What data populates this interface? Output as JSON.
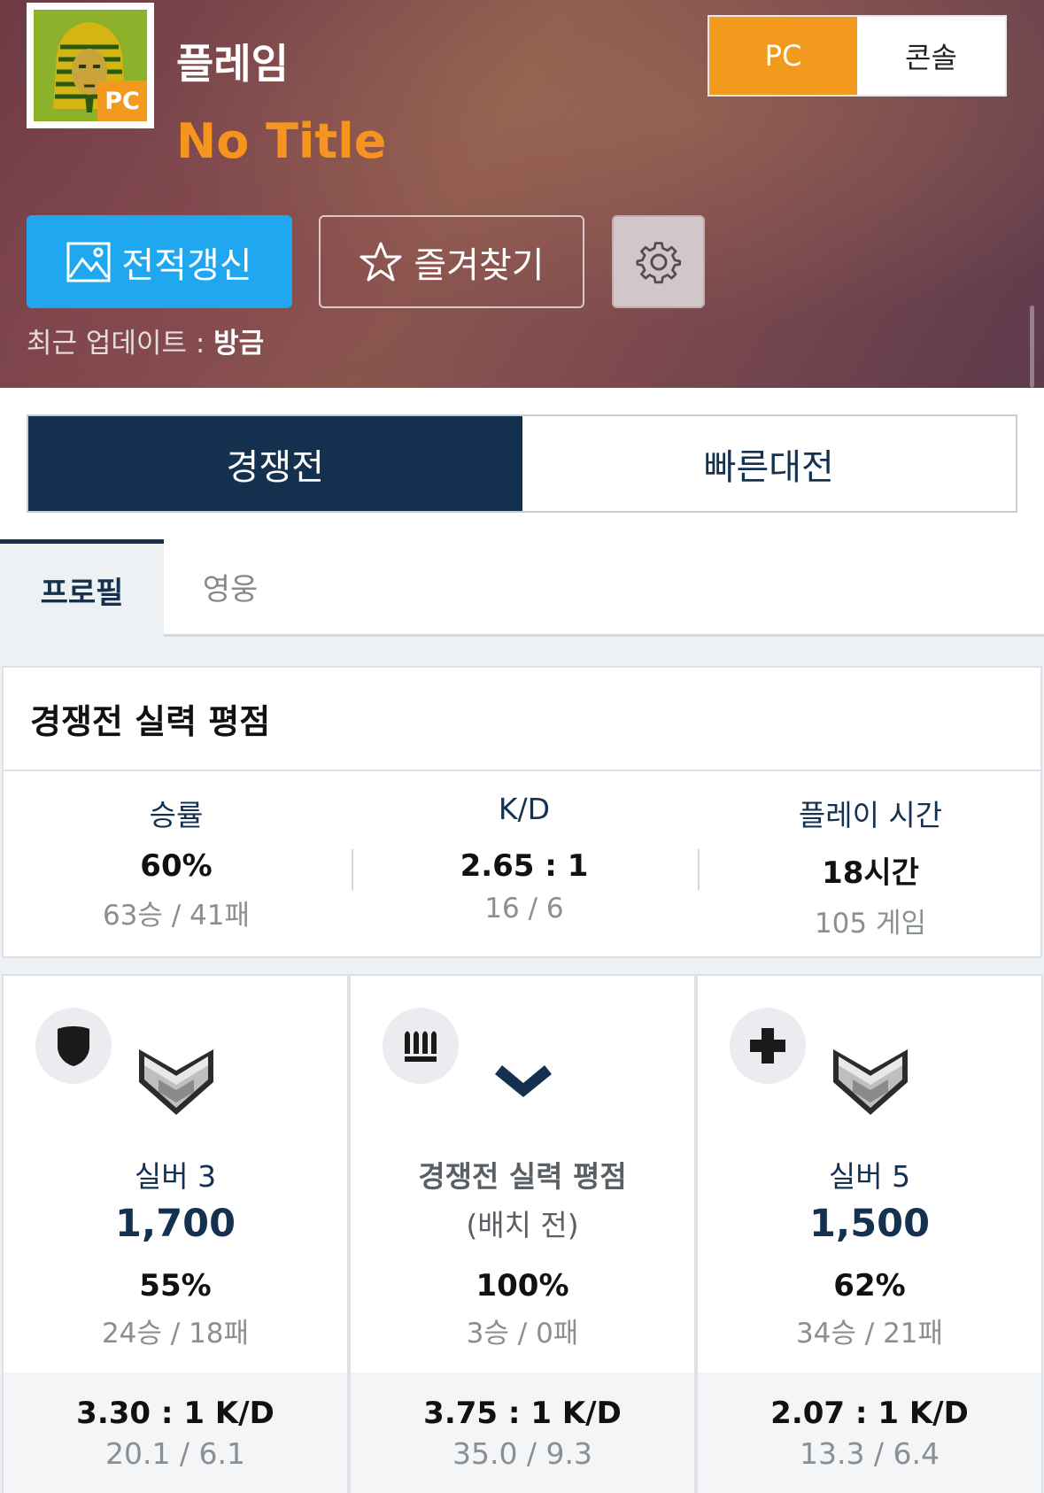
{
  "header": {
    "player_name": "플레임",
    "player_title": "No Title",
    "avatar_badge": "PC",
    "platform_tabs": [
      "PC",
      "콘솔"
    ],
    "refresh_label": "전적갱신",
    "favorite_label": "즐겨찾기",
    "last_update_label": "최근 업데이트 : ",
    "last_update_value": "방금"
  },
  "mode_tabs": [
    "경쟁전",
    "빠른대전"
  ],
  "sub_tabs": [
    "프로필",
    "영웅"
  ],
  "summary": {
    "title": "경쟁전 실력 평점",
    "stats": [
      {
        "label": "승률",
        "value": "60%",
        "sub": "63승 / 41패"
      },
      {
        "label": "K/D",
        "value": "2.65 : 1",
        "sub": "16 / 6"
      },
      {
        "label": "플레이 시간",
        "value": "18시간",
        "sub": "105 게임"
      }
    ]
  },
  "roles": [
    {
      "role_icon": "shield-icon",
      "rank_name": "실버 3",
      "sr": "1,700",
      "winrate": "55%",
      "record": "24승 / 18패",
      "kd": "3.30 : 1 K/D",
      "kd_detail": "20.1 / 6.1"
    },
    {
      "role_icon": "ammo-icon",
      "placement_title": "경쟁전 실력 평점",
      "placement_sub": "(배치 전)",
      "winrate": "100%",
      "record": "3승 / 0패",
      "kd": "3.75 : 1 K/D",
      "kd_detail": "35.0 / 9.3"
    },
    {
      "role_icon": "plus-icon",
      "rank_name": "실버 5",
      "sr": "1,500",
      "winrate": "62%",
      "record": "34승 / 21패",
      "kd": "2.07 : 1 K/D",
      "kd_detail": "13.3 / 6.4"
    }
  ],
  "colors": {
    "accent_orange": "#f29a1d",
    "refresh_blue": "#1fa7ef",
    "navy": "#14324f"
  }
}
